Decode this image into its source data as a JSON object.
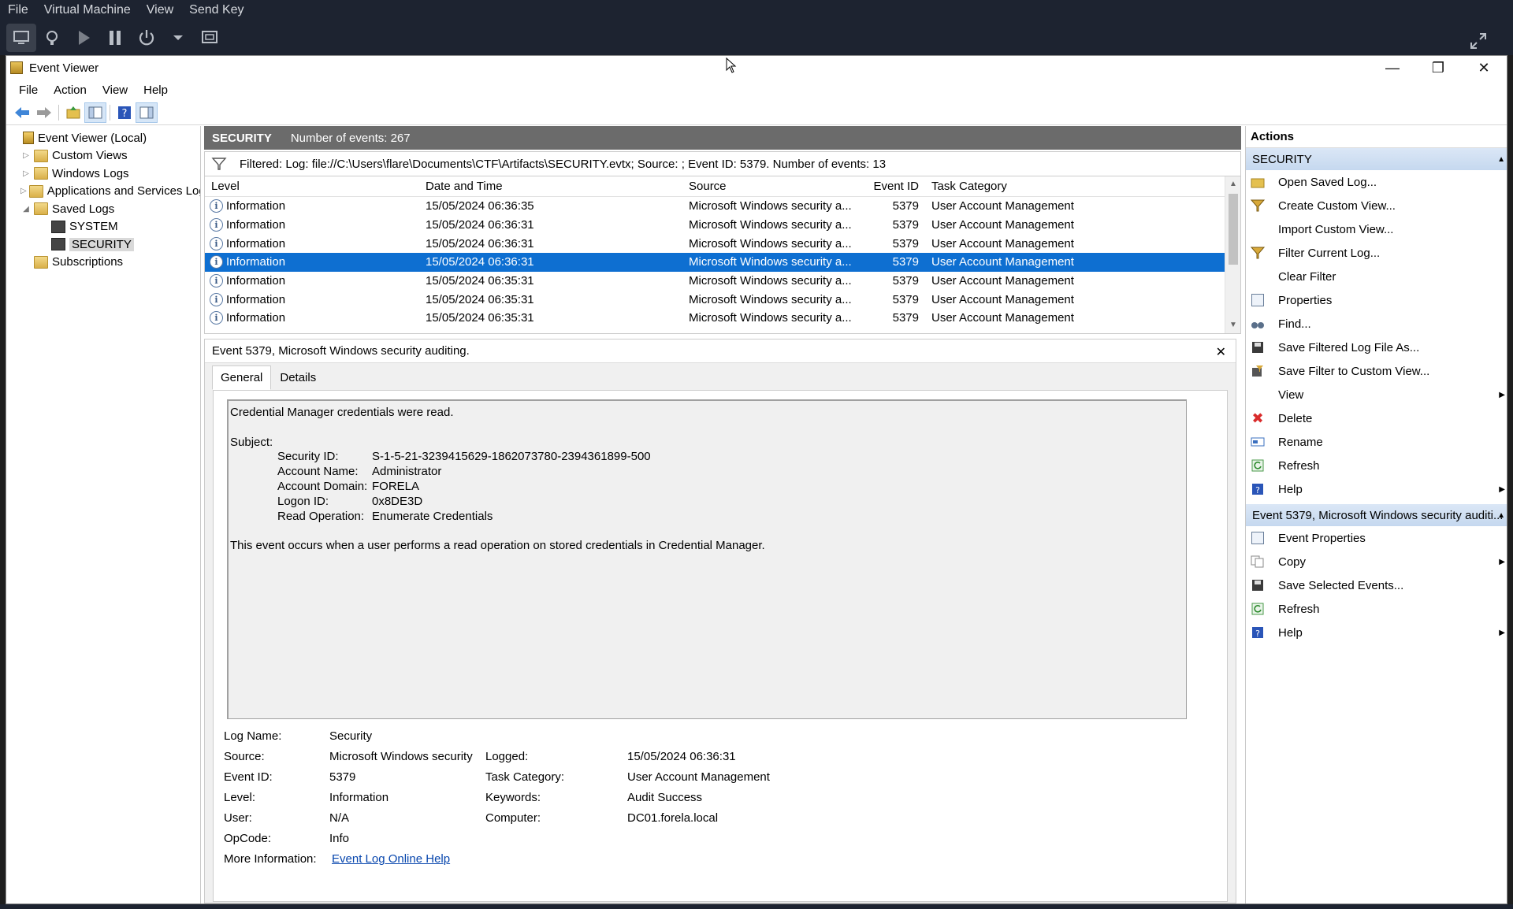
{
  "vm": {
    "menu": [
      "File",
      "Virtual Machine",
      "View",
      "Send Key"
    ],
    "toolbar_icons": [
      "monitor-icon",
      "lightbulb-icon",
      "play-icon",
      "pause-icon",
      "power-icon",
      "dropdown-arrow-icon",
      "snapshot-icon",
      "fullscreen-icon"
    ]
  },
  "window": {
    "title": "Event Viewer",
    "menu": [
      "File",
      "Action",
      "View",
      "Help"
    ]
  },
  "tree": {
    "items": [
      {
        "label": "Event Viewer (Local)",
        "level": 0,
        "arrow": ""
      },
      {
        "label": "Custom Views",
        "level": 1,
        "arrow": "▷"
      },
      {
        "label": "Windows Logs",
        "level": 1,
        "arrow": "▷"
      },
      {
        "label": "Applications and Services Logs",
        "level": 1,
        "arrow": "▷"
      },
      {
        "label": "Saved Logs",
        "level": 1,
        "arrow": "◢"
      },
      {
        "label": "SYSTEM",
        "level": 2,
        "arrow": ""
      },
      {
        "label": "SECURITY",
        "level": 2,
        "arrow": "",
        "selected": true
      },
      {
        "label": "Subscriptions",
        "level": 1,
        "arrow": ""
      }
    ]
  },
  "log_header": {
    "name": "SECURITY",
    "count": "Number of events: 267"
  },
  "filter": {
    "text": "Filtered: Log: file://C:\\Users\\flare\\Documents\\CTF\\Artifacts\\SECURITY.evtx; Source: ; Event ID: 5379. Number of events: 13"
  },
  "grid": {
    "columns": [
      "Level",
      "Date and Time",
      "Source",
      "Event ID",
      "Task Category"
    ],
    "rows": [
      {
        "level": "Information",
        "date": "15/05/2024 06:36:35",
        "source": "Microsoft Windows security a...",
        "id": "5379",
        "cat": "User Account Management"
      },
      {
        "level": "Information",
        "date": "15/05/2024 06:36:31",
        "source": "Microsoft Windows security a...",
        "id": "5379",
        "cat": "User Account Management"
      },
      {
        "level": "Information",
        "date": "15/05/2024 06:36:31",
        "source": "Microsoft Windows security a...",
        "id": "5379",
        "cat": "User Account Management"
      },
      {
        "level": "Information",
        "date": "15/05/2024 06:36:31",
        "source": "Microsoft Windows security a...",
        "id": "5379",
        "cat": "User Account Management",
        "selected": true
      },
      {
        "level": "Information",
        "date": "15/05/2024 06:35:31",
        "source": "Microsoft Windows security a...",
        "id": "5379",
        "cat": "User Account Management"
      },
      {
        "level": "Information",
        "date": "15/05/2024 06:35:31",
        "source": "Microsoft Windows security a...",
        "id": "5379",
        "cat": "User Account Management"
      },
      {
        "level": "Information",
        "date": "15/05/2024 06:35:31",
        "source": "Microsoft Windows security a...",
        "id": "5379",
        "cat": "User Account Management"
      }
    ]
  },
  "detail": {
    "title": "Event 5379, Microsoft Windows security auditing.",
    "tabs": [
      "General",
      "Details"
    ],
    "message": {
      "line1": "Credential Manager credentials were read.",
      "subject": "Subject:",
      "fields": [
        {
          "k": "Security ID:",
          "v": "S-1-5-21-3239415629-1862073780-2394361899-500"
        },
        {
          "k": "Account Name:",
          "v": "Administrator"
        },
        {
          "k": "Account Domain:",
          "v": "FORELA"
        },
        {
          "k": "Logon ID:",
          "v": "0x8DE3D"
        },
        {
          "k": "Read Operation:",
          "v": "Enumerate Credentials"
        }
      ],
      "footer": "This event occurs when a user performs a read operation on stored credentials in Credential Manager."
    },
    "meta": {
      "log_name_k": "Log Name:",
      "log_name_v": "Security",
      "source_k": "Source:",
      "source_v": "Microsoft Windows security a",
      "logged_k": "Logged:",
      "logged_v": "15/05/2024 06:36:31",
      "event_id_k": "Event ID:",
      "event_id_v": "5379",
      "task_cat_k": "Task Category:",
      "task_cat_v": "User Account Management",
      "level_k": "Level:",
      "level_v": "Information",
      "keywords_k": "Keywords:",
      "keywords_v": "Audit Success",
      "user_k": "User:",
      "user_v": "N/A",
      "computer_k": "Computer:",
      "computer_v": "DC01.forela.local",
      "opcode_k": "OpCode:",
      "opcode_v": "Info",
      "more_k": "More Information:",
      "more_link": "Event Log Online Help"
    }
  },
  "actions": {
    "header": "Actions",
    "section1": "SECURITY",
    "items1": [
      {
        "label": "Open Saved Log...",
        "icon": "open-folder-icon"
      },
      {
        "label": "Create Custom View...",
        "icon": "filter-icon"
      },
      {
        "label": "Import Custom View...",
        "icon": ""
      },
      {
        "label": "Filter Current Log...",
        "icon": "filter-icon"
      },
      {
        "label": "Clear Filter",
        "icon": ""
      },
      {
        "label": "Properties",
        "icon": "properties-icon"
      },
      {
        "label": "Find...",
        "icon": "binoculars-icon"
      },
      {
        "label": "Save Filtered Log File As...",
        "icon": "save-icon"
      },
      {
        "label": "Save Filter to Custom View...",
        "icon": "save-filter-icon"
      },
      {
        "label": "View",
        "icon": "",
        "sub": true
      },
      {
        "label": "Delete",
        "icon": "delete-icon"
      },
      {
        "label": "Rename",
        "icon": "rename-icon"
      },
      {
        "label": "Refresh",
        "icon": "refresh-icon"
      },
      {
        "label": "Help",
        "icon": "help-icon",
        "sub": true
      }
    ],
    "section2": "Event 5379, Microsoft Windows security auditi...",
    "items2": [
      {
        "label": "Event Properties",
        "icon": "properties-icon"
      },
      {
        "label": "Copy",
        "icon": "copy-icon",
        "sub": true
      },
      {
        "label": "Save Selected Events...",
        "icon": "save-icon"
      },
      {
        "label": "Refresh",
        "icon": "refresh-icon"
      },
      {
        "label": "Help",
        "icon": "help-icon",
        "sub": true
      }
    ]
  },
  "colors": {
    "selection": "#0e6fd1",
    "header_bar": "#6b6b6b",
    "vm_chrome": "#1d2330",
    "action_section": "#c5d8ef"
  }
}
